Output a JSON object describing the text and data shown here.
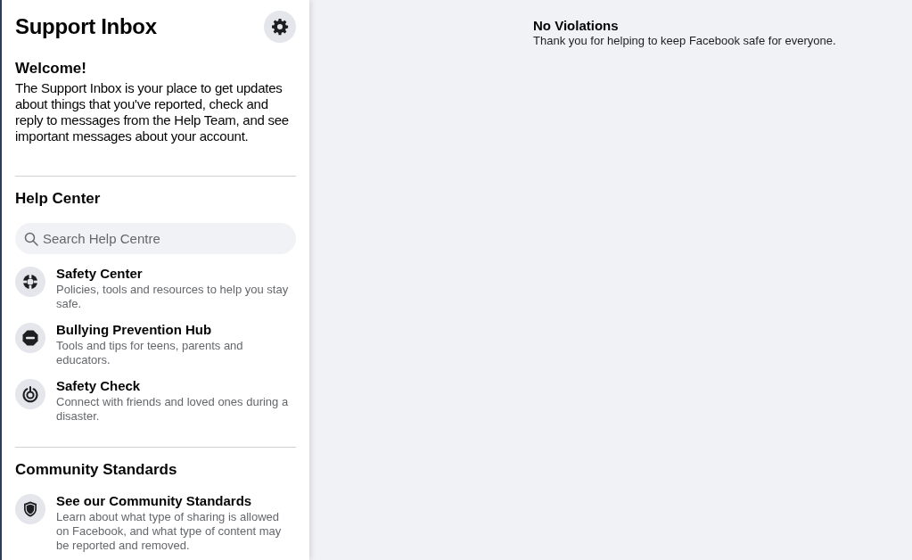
{
  "sidebar": {
    "title": "Support Inbox",
    "welcome": {
      "heading": "Welcome!",
      "text": "The Support Inbox is your place to get updates about things that you've reported, check and reply to messages from the Help Team, and see important messages about your account."
    },
    "sections": [
      {
        "heading": "Help Center",
        "search": {
          "placeholder": "Search Help Centre"
        },
        "items": [
          {
            "kind": "lifebuoy",
            "title": "Safety Center",
            "description": "Policies, tools and resources to help you stay safe."
          },
          {
            "kind": "stop",
            "title": "Bullying Prevention Hub",
            "description": "Tools and tips for teens, parents and educators."
          },
          {
            "kind": "power",
            "title": "Safety Check",
            "description": "Connect with friends and loved ones during a disaster."
          }
        ]
      },
      {
        "heading": "Community Standards",
        "items": [
          {
            "kind": "shield",
            "title": "See our Community Standards",
            "description": "Learn about what type of sharing is allowed on Facebook, and what type of content may be reported and removed."
          }
        ]
      }
    ]
  },
  "main": {
    "heading": "No Violations",
    "text": "Thank you for helping to keep Facebook safe for everyone."
  }
}
